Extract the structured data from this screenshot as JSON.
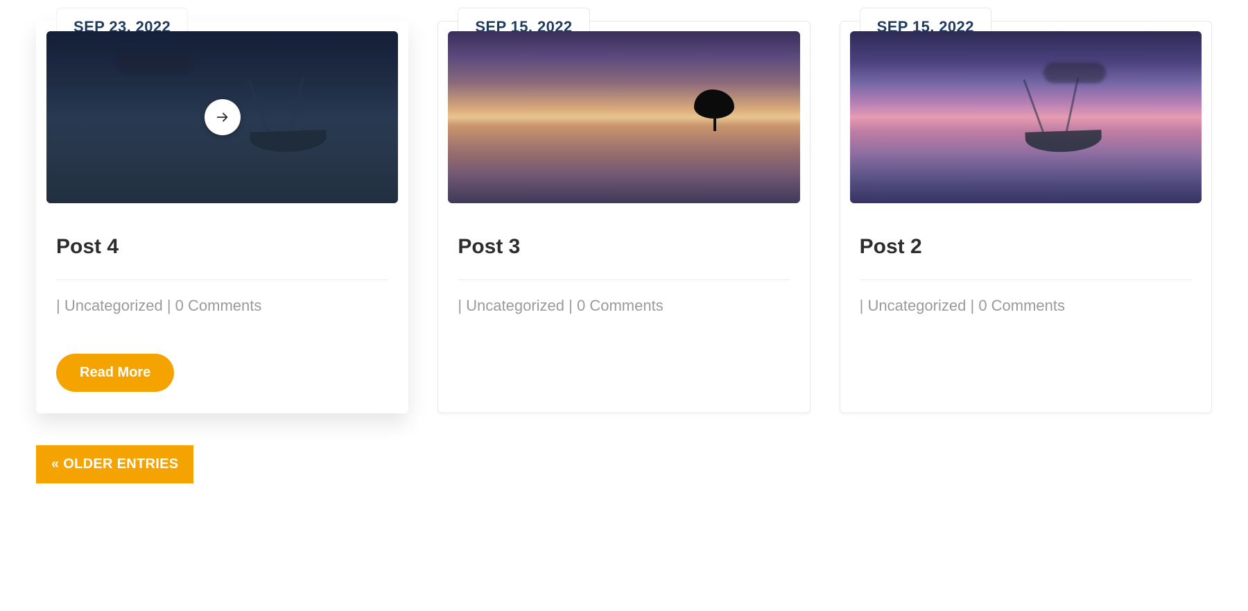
{
  "posts": [
    {
      "date": "SEP 23, 2022",
      "title": "Post 4",
      "category": "Uncategorized",
      "comments": "0 Comments",
      "read_more": "Read More",
      "image_desc": "calm dark blue seascape with small boat at dusk"
    },
    {
      "date": "SEP 15, 2022",
      "title": "Post 3",
      "category": "Uncategorized",
      "comments": "0 Comments",
      "image_desc": "purple and orange sunset over still water with lone tree silhouette"
    },
    {
      "date": "SEP 15, 2022",
      "title": "Post 2",
      "category": "Uncategorized",
      "comments": "0 Comments",
      "image_desc": "vivid pink and purple sunset over water with small boat"
    }
  ],
  "meta_separator": " | ",
  "pagination": {
    "older": "« OLDER ENTRIES"
  }
}
